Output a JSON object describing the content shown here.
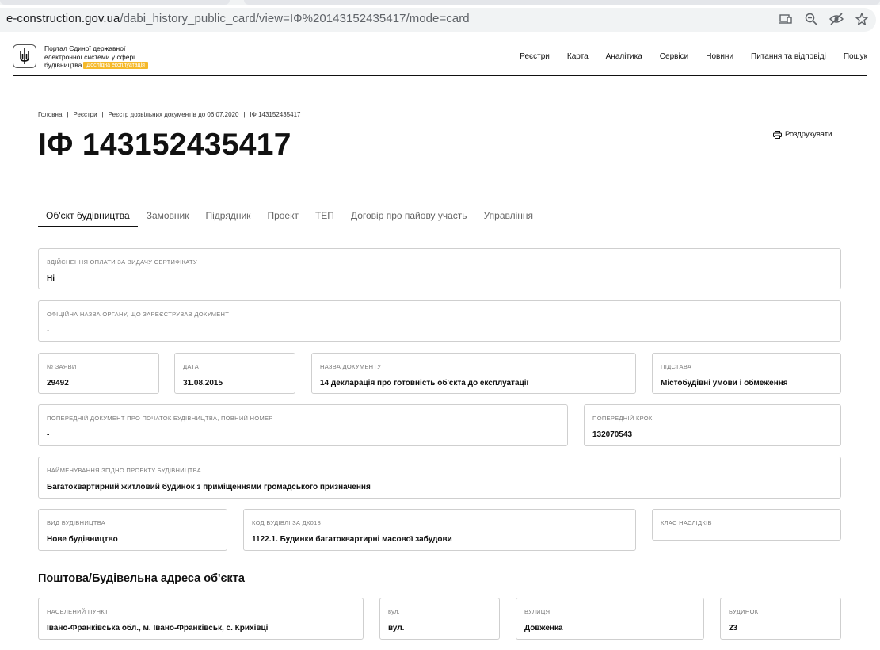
{
  "browser": {
    "url_host": "e-construction.gov.ua",
    "url_path": "/dabi_history_public_card/view=IФ%20143152435417/mode=card",
    "icons": [
      "install-app-icon",
      "zoom-icon",
      "tracking-protection-icon",
      "bookmark-star-icon"
    ]
  },
  "header": {
    "portal_line1": "Портал Єдиної державної",
    "portal_line2": "електронної системи у сфері",
    "portal_line3": "будівництва",
    "beta": "Дослідна експлуатація",
    "nav": [
      "Реєстри",
      "Карта",
      "Аналітика",
      "Сервіси",
      "Новини",
      "Питання та відповіді",
      "Пошук"
    ]
  },
  "breadcrumb": [
    "Головна",
    "Реєстри",
    "Реєстр дозвільних документів до 06.07.2020",
    "ІФ 143152435417"
  ],
  "title": "ІФ 143152435417",
  "print_label": "Роздрукувати",
  "tabs": [
    "Об'єкт будівництва",
    "Замовник",
    "Підрядник",
    "Проект",
    "ТЕП",
    "Договір про пайову участь",
    "Управління"
  ],
  "fields": {
    "payment": {
      "label": "Здійснення оплати за видачу сертифікату",
      "value": "Ні"
    },
    "authority": {
      "label": "Офіційна назва органу, що зареєстрував документ",
      "value": "-"
    },
    "app_no": {
      "label": "№ заяви",
      "value": "29492"
    },
    "date": {
      "label": "Дата",
      "value": "31.08.2015"
    },
    "doc_name": {
      "label": "Назва документу",
      "value": "14 декларація про готовність об'єкта до експлуатації"
    },
    "basis": {
      "label": "Підстава",
      "value": "Містобудівні умови і обмеження"
    },
    "prev_doc": {
      "label": "Попередній документ про початок будівництва, повний номер",
      "value": "-"
    },
    "prev_step": {
      "label": "Попередній крок",
      "value": "132070543"
    },
    "project_name": {
      "label": "Найменування згідно проекту будівництва",
      "value": "Багатоквартирний житловий будинок з приміщеннями громадського призначення"
    },
    "construction_type": {
      "label": "Вид будівництва",
      "value": "Нове будівництво"
    },
    "building_code": {
      "label": "Код будівлі за ДК018",
      "value": "1122.1. Будинки багатоквартирні масової забудови"
    },
    "consequence_class": {
      "label": "Клас наслідків",
      "value": ""
    }
  },
  "address": {
    "title": "Поштова/Будівельна адреса об'єкта",
    "locality": {
      "label": "Населений пункт",
      "value": "Івано-Франківська обл., м. Івано-Франківськ, с. Крихівці"
    },
    "street_type": {
      "label": "вул.",
      "value": "вул."
    },
    "street": {
      "label": "Вулиця",
      "value": "Довженка"
    },
    "building": {
      "label": "Будинок",
      "value": "23"
    }
  }
}
